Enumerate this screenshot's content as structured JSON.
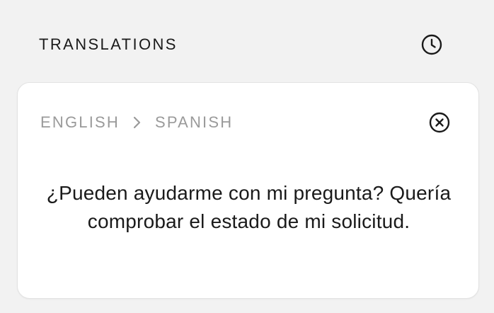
{
  "header": {
    "title": "TRANSLATIONS",
    "history_icon": "clock-icon"
  },
  "card": {
    "source_language": "ENGLISH",
    "target_language": "SPANISH",
    "separator_icon": "chevron-right-icon",
    "close_icon": "close-circle-icon",
    "translated_text": "¿Pueden ayudarme con mi pregunta? Quería comprobar el estado de mi solicitud."
  },
  "colors": {
    "background": "#f2f2f2",
    "card_background": "#ffffff",
    "text_primary": "#1a1a1a",
    "text_muted": "#9a9a9a"
  }
}
